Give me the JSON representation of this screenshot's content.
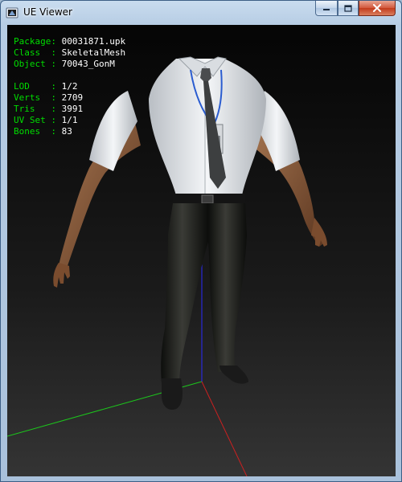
{
  "window": {
    "title": "UE Viewer",
    "icon": "ue-viewer-app-icon"
  },
  "titlebar_buttons": {
    "minimize": "minimize-icon",
    "maximize": "maximize-icon",
    "close": "close-icon"
  },
  "info": {
    "package": {
      "label": "Package",
      "sep": ": ",
      "value": "00031871.upk"
    },
    "class": {
      "label": "Class  ",
      "sep": ": ",
      "value": "SkeletalMesh"
    },
    "object": {
      "label": "Object ",
      "sep": ": ",
      "value": "70043_GonM"
    },
    "lod": {
      "label": "LOD    ",
      "sep": ": ",
      "value": "1/2"
    },
    "verts": {
      "label": "Verts  ",
      "sep": ": ",
      "value": "2709"
    },
    "tris": {
      "label": "Tris   ",
      "sep": ": ",
      "value": "3991"
    },
    "uvset": {
      "label": "UV Set ",
      "sep": ": ",
      "value": "1/1"
    },
    "bones": {
      "label": "Bones  ",
      "sep": ": ",
      "value": "83"
    }
  },
  "colors": {
    "label_green": "#00dd00",
    "value_white": "#ffffff",
    "axis_x": "#cc2020",
    "axis_y": "#1cc61c",
    "axis_z": "#2a2aff",
    "shirt": "#e9ecef",
    "pants": "#1e1f1c",
    "skin": "#8a5a3a",
    "tie": "#3d3f40",
    "lanyard": "#2a5cd0"
  }
}
